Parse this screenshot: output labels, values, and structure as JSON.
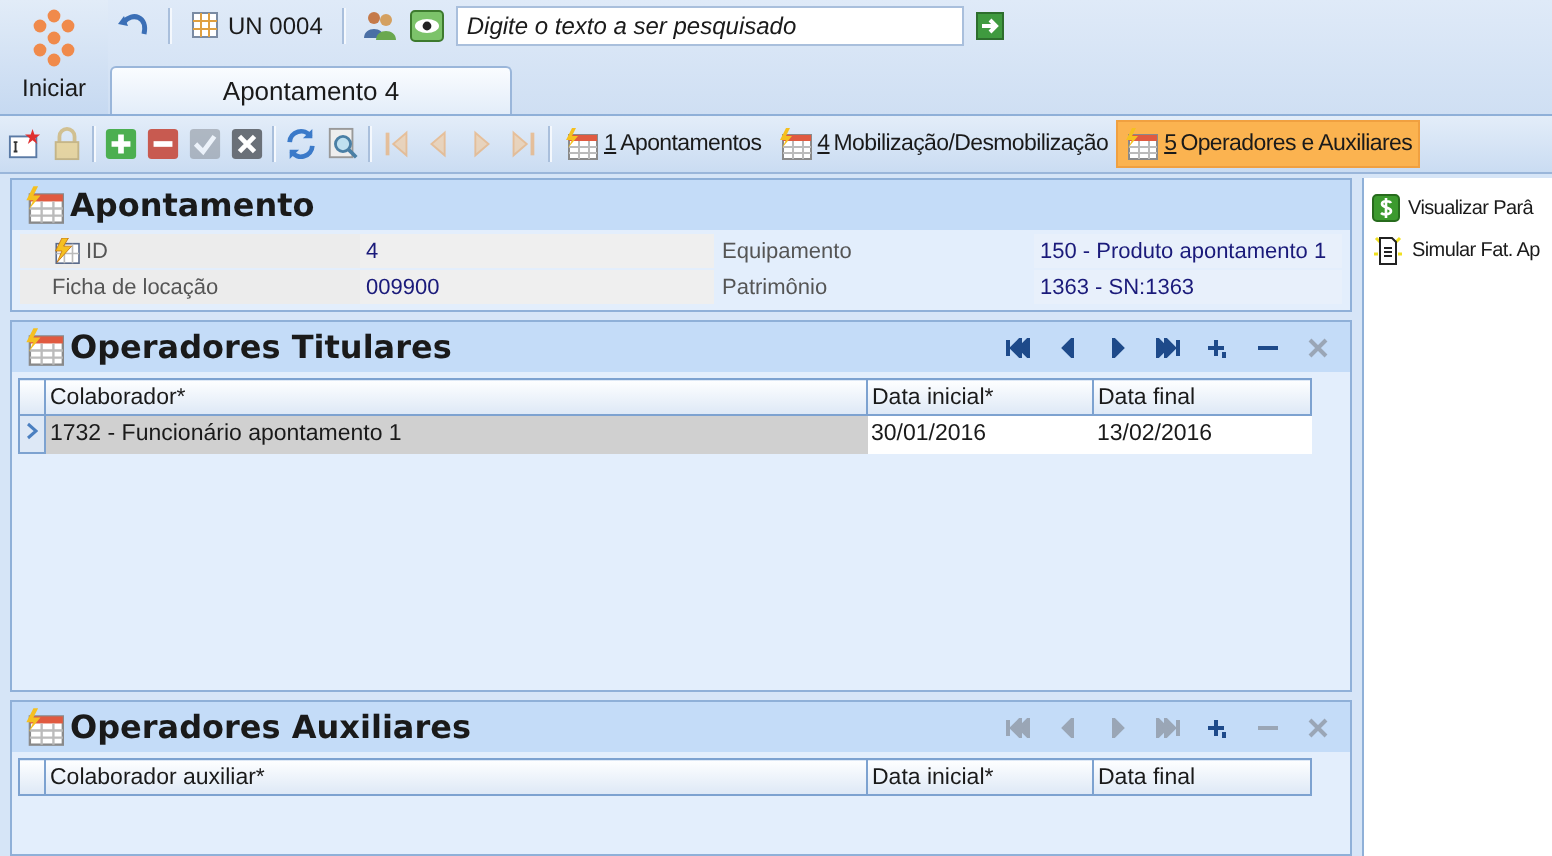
{
  "start": {
    "label": "Iniciar"
  },
  "topbar": {
    "unit": "UN 0004",
    "search": {
      "placeholder": "Digite o texto a ser pesquisado"
    }
  },
  "tabs": [
    {
      "label": "Apontamento 4",
      "selected": true
    }
  ],
  "toolbar": {
    "buttons": [
      {
        "kind": "new",
        "disabled": false
      },
      {
        "kind": "lock",
        "disabled": true
      },
      {
        "kind": "add",
        "disabled": false
      },
      {
        "kind": "remove",
        "disabled": false
      },
      {
        "kind": "confirm",
        "disabled": true
      },
      {
        "kind": "cancel",
        "disabled": false
      },
      {
        "kind": "refresh",
        "disabled": false
      },
      {
        "kind": "preview",
        "disabled": false
      },
      {
        "kind": "first",
        "disabled": true
      },
      {
        "kind": "prev",
        "disabled": true
      },
      {
        "kind": "next",
        "disabled": true
      },
      {
        "kind": "last",
        "disabled": true
      }
    ],
    "links": [
      {
        "key": "1",
        "label": "Apontamentos",
        "selected": false
      },
      {
        "key": "4",
        "label": "Mobilização/Desmobilização",
        "selected": false
      },
      {
        "key": "5",
        "label": "Operadores e Auxiliares",
        "selected": true
      }
    ]
  },
  "record": {
    "title": "Apontamento",
    "fields": [
      {
        "label": "ID",
        "value": "4",
        "key_icon": true
      },
      {
        "label": "Equipamento",
        "value": "150 - Produto apontamento 1",
        "key_icon": false
      },
      {
        "label": "Ficha de locação",
        "value": "009900",
        "key_icon": false
      },
      {
        "label": "Patrimônio",
        "value": "1363 - SN:1363",
        "key_icon": false
      }
    ]
  },
  "grids": [
    {
      "title": "Operadores Titulares",
      "nav": [
        {
          "kind": "first",
          "disabled": false
        },
        {
          "kind": "prev",
          "disabled": false
        },
        {
          "kind": "next",
          "disabled": false
        },
        {
          "kind": "last",
          "disabled": false
        },
        {
          "kind": "add",
          "disabled": false
        },
        {
          "kind": "remove",
          "disabled": false
        },
        {
          "kind": "cancel",
          "disabled": true
        }
      ],
      "columns": [
        "Colaborador*",
        "Data inicial*",
        "Data final"
      ],
      "rows": [
        {
          "cells": [
            "1732 - Funcionário apontamento 1",
            "30/01/2016",
            "13/02/2016"
          ],
          "selected": true
        }
      ]
    },
    {
      "title": "Operadores Auxiliares",
      "nav": [
        {
          "kind": "first",
          "disabled": true
        },
        {
          "kind": "prev",
          "disabled": true
        },
        {
          "kind": "next",
          "disabled": true
        },
        {
          "kind": "last",
          "disabled": true
        },
        {
          "kind": "add",
          "disabled": false
        },
        {
          "kind": "remove",
          "disabled": true
        },
        {
          "kind": "cancel",
          "disabled": true
        }
      ],
      "columns": [
        "Colaborador auxiliar*",
        "Data inicial*",
        "Data final"
      ]
    }
  ],
  "side": {
    "items": [
      {
        "kind": "money",
        "label": "Visualizar Parâ"
      },
      {
        "kind": "document",
        "label": "Simular Fat. Ap"
      }
    ]
  }
}
